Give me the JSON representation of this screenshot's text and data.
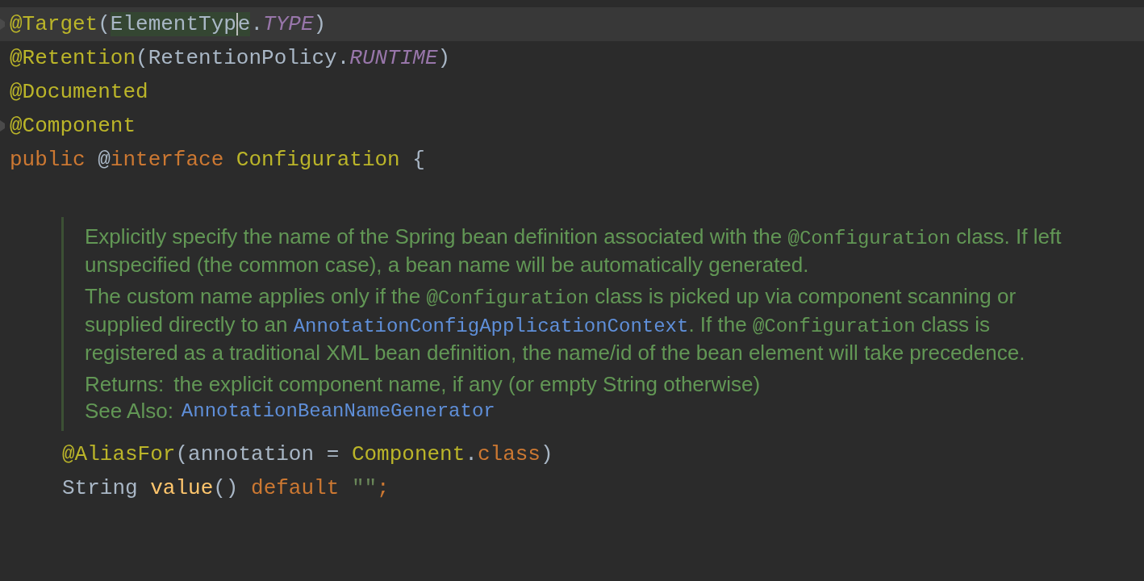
{
  "header_lines": [
    {
      "current": true,
      "fold_marker": true,
      "tokens": [
        {
          "kind": "annotation",
          "text": "@Target"
        },
        {
          "kind": "plain",
          "text": "("
        },
        {
          "kind": "plain",
          "text": "ElementTyp",
          "highlighted": true,
          "caret_after": true
        },
        {
          "kind": "plain",
          "text": "e",
          "highlighted": true
        },
        {
          "kind": "plain",
          "text": "."
        },
        {
          "kind": "constant",
          "text": "TYPE"
        },
        {
          "kind": "plain",
          "text": ")"
        }
      ]
    },
    {
      "current": false,
      "fold_marker": false,
      "tokens": [
        {
          "kind": "annotation",
          "text": "@Retention"
        },
        {
          "kind": "plain",
          "text": "(RetentionPolicy."
        },
        {
          "kind": "constant",
          "text": "RUNTIME"
        },
        {
          "kind": "plain",
          "text": ")"
        }
      ]
    },
    {
      "current": false,
      "fold_marker": false,
      "tokens": [
        {
          "kind": "annotation",
          "text": "@Documented"
        }
      ]
    },
    {
      "current": false,
      "fold_marker": true,
      "tokens": [
        {
          "kind": "annotation",
          "text": "@Component"
        }
      ]
    },
    {
      "current": false,
      "fold_marker": false,
      "tokens": [
        {
          "kind": "keyword",
          "text": "public "
        },
        {
          "kind": "plain",
          "text": "@"
        },
        {
          "kind": "keyword",
          "text": "interface "
        },
        {
          "kind": "annotation",
          "text": "Configuration "
        },
        {
          "kind": "plain",
          "text": "{"
        }
      ]
    }
  ],
  "doc": {
    "paragraphs": [
      [
        {
          "kind": "text",
          "text": "Explicitly specify the name of the Spring bean definition associated with the "
        },
        {
          "kind": "code",
          "text": "@Configuration"
        },
        {
          "kind": "text",
          "text": " class. If left unspecified (the common case), a bean name will be automatically generated."
        }
      ],
      [
        {
          "kind": "text",
          "text": "The custom name applies only if the "
        },
        {
          "kind": "code",
          "text": "@Configuration"
        },
        {
          "kind": "text",
          "text": " class is picked up via component scanning or supplied directly to an "
        },
        {
          "kind": "link",
          "text": "AnnotationConfigApplicationContext"
        },
        {
          "kind": "text",
          "text": ". If the "
        },
        {
          "kind": "code",
          "text": "@Configuration"
        },
        {
          "kind": "text",
          "text": " class is registered as a traditional XML bean definition, the name/id of the bean element will take precedence."
        }
      ]
    ],
    "returns": {
      "label": "Returns:",
      "text": "the explicit component name, if any (or empty String otherwise)"
    },
    "see_also": {
      "label": "See Also:",
      "link": "AnnotationBeanNameGenerator"
    }
  },
  "member_lines": [
    {
      "current": false,
      "fold_marker": false,
      "tokens": [
        {
          "kind": "annotation",
          "text": "@AliasFor"
        },
        {
          "kind": "plain",
          "text": "(annotation = "
        },
        {
          "kind": "annotation",
          "text": "Component"
        },
        {
          "kind": "plain",
          "text": "."
        },
        {
          "kind": "keyword",
          "text": "class"
        },
        {
          "kind": "plain",
          "text": ")"
        }
      ]
    },
    {
      "current": false,
      "fold_marker": false,
      "tokens": [
        {
          "kind": "plain",
          "text": "String "
        },
        {
          "kind": "method",
          "text": "value"
        },
        {
          "kind": "plain",
          "text": "() "
        },
        {
          "kind": "keyword",
          "text": "default "
        },
        {
          "kind": "string",
          "text": "\"\""
        },
        {
          "kind": "keyword",
          "text": ";"
        }
      ]
    }
  ]
}
